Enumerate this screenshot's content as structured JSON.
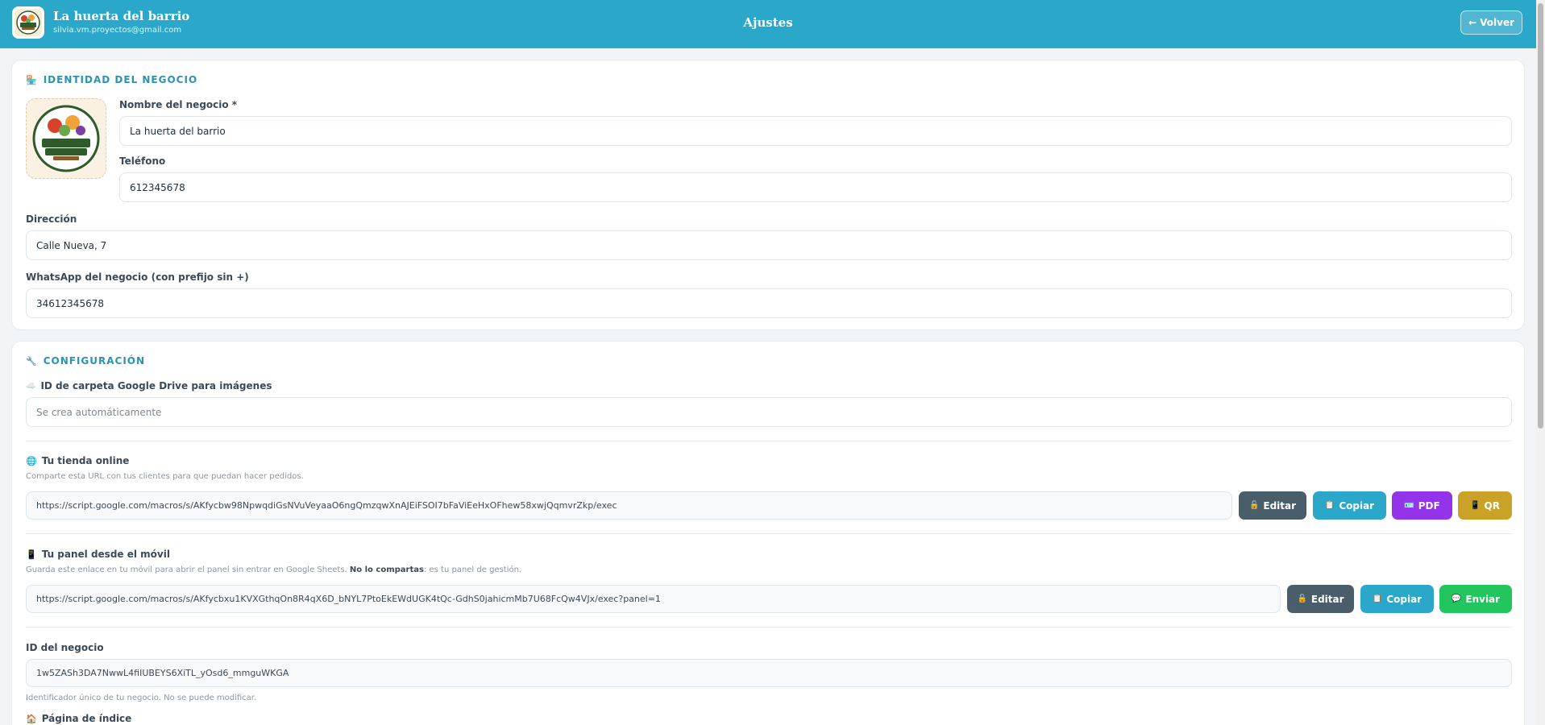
{
  "header": {
    "business_name": "La huerta del barrio",
    "email": "silvia.vm.proyectos@gmail.com",
    "title": "Ajustes",
    "back_label": "← Volver",
    "brand_color": "#2aa7c9"
  },
  "identity": {
    "section_title": "IDENTIDAD DEL NEGOCIO",
    "section_icon": "store-icon",
    "logo_icon": "fruteria-verduleria-logo",
    "name_label": "Nombre del negocio *",
    "name_value": "La huerta del barrio",
    "phone_label": "Teléfono",
    "phone_value": "612345678",
    "address_label": "Dirección",
    "address_value": "Calle Nueva, 7",
    "whatsapp_label": "WhatsApp del negocio (con prefijo sin +)",
    "whatsapp_value": "34612345678"
  },
  "config": {
    "section_title": "CONFIGURACIÓN",
    "section_icon": "wrench-icon",
    "drive_label": "ID de carpeta Google Drive para imágenes",
    "drive_icon": "cloud-icon",
    "drive_placeholder": "Se crea automáticamente",
    "store": {
      "label": "Tu tienda online",
      "icon": "globe-icon",
      "help": "Comparte esta URL con tus clientes para que puedan hacer pedidos.",
      "url": "https://script.google.com/macros/s/AKfycbw98NpwqdiGsNVuVeyaaO6ngQmzqwXnAJEiFSOI7bFaViEeHxOFhew58xwjQqmvrZkp/exec",
      "edit_label": "Editar",
      "copy_label": "Copiar",
      "pdf_label": "PDF",
      "qr_label": "QR"
    },
    "panel": {
      "label": "Tu panel desde el móvil",
      "icon": "mobile-icon",
      "help_pre": "Guarda este enlace en tu móvil para abrir el panel sin entrar en Google Sheets.",
      "help_bold": "No lo compartas",
      "help_post": ": es tu panel de gestión.",
      "url": "https://script.google.com/macros/s/AKfycbxu1KVXGthqOn8R4qX6D_bNYL7PtoEkEWdUGK4tQc-GdhS0jahicmMb7U68FcQw4VJx/exec?panel=1",
      "edit_label": "Editar",
      "copy_label": "Copiar",
      "send_label": "Enviar"
    },
    "business_id": {
      "label": "ID del negocio",
      "value": "1w5ZASh3DA7NwwL4fiIUBEYS6XiTL_yOsd6_mmguWKGA",
      "help": "Identificador único de tu negocio. No se puede modificar."
    },
    "index_page": {
      "label": "Página de índice",
      "icon": "house-icon"
    }
  }
}
